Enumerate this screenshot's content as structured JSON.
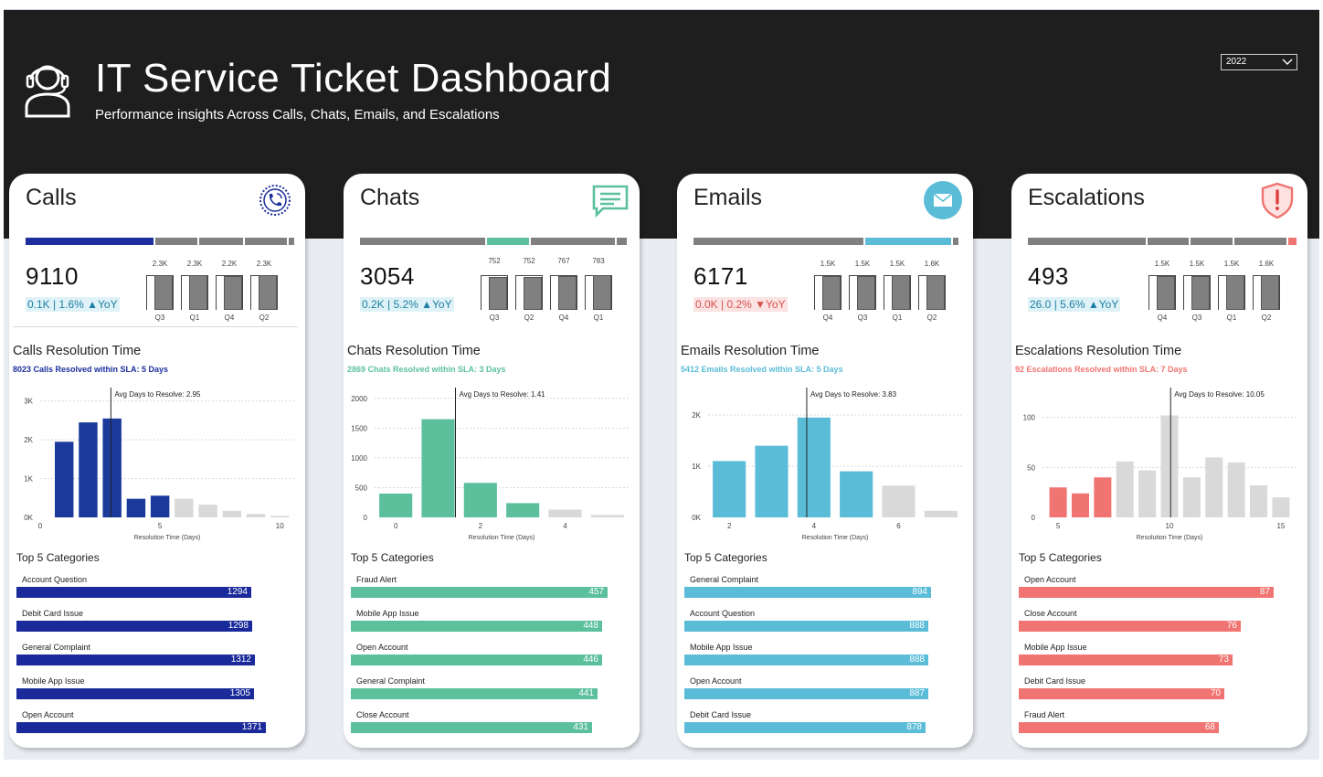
{
  "header": {
    "title": "IT Service Ticket Dashboard",
    "subtitle": "Performance insights Across Calls, Chats, Emails, and Escalations",
    "year_filter": "2022"
  },
  "common": {
    "top5_title": "Top 5 Categories",
    "avg_prefix": "Avg Days to Resolve: ",
    "x_axis_label": "Resolution Time (Days)"
  },
  "cards": [
    {
      "key": "calls",
      "title": "Calls",
      "icon": "phone-icon",
      "color": "#1c2f9c",
      "total": "9110",
      "yoy": "0.1K | 1.6% ▲YoY",
      "yoy_color": "#1c7fa3",
      "yoy_bg": "#dff2f7",
      "share_bar": [
        0.49,
        0.16,
        0.17,
        0.16,
        0.02
      ],
      "share_highlight": 0,
      "quarters": {
        "labels": [
          "Q3",
          "Q1",
          "Q4",
          "Q2"
        ],
        "values": [
          "2.3K",
          "2.3K",
          "2.2K",
          "2.3K"
        ],
        "fills": [
          0.99,
          1.0,
          0.98,
          0.99
        ]
      },
      "resolution_title": "Calls Resolution Time",
      "sla_text": "8023 Calls Resolved within SLA: 5 Days",
      "sla_color": "#1c2f9c",
      "avg_days": "2.95",
      "chart_data": {
        "type": "bar",
        "x": [
          1,
          2,
          3,
          4,
          5,
          6,
          7,
          8,
          9,
          10
        ],
        "values": [
          1950,
          2450,
          2550,
          480,
          560,
          480,
          330,
          170,
          90,
          40
        ],
        "highlight_upto": 5,
        "highlight_color": "#1c3a9c",
        "other_color": "#d9d9d9",
        "xticks": [
          "0",
          "5",
          "10"
        ],
        "xtick_vals": [
          0,
          5,
          10
        ],
        "yticks": [
          "0K",
          "1K",
          "2K",
          "3K"
        ],
        "ytick_vals": [
          0,
          1000,
          2000,
          3000
        ],
        "xlim": [
          0,
          10.6
        ],
        "ylim": [
          0,
          3300
        ],
        "avg": 2.95
      },
      "top_categories": [
        {
          "name": "Account Question",
          "value": "1294",
          "frac": 0.858
        },
        {
          "name": "Debit Card Issue",
          "value": "1298",
          "frac": 0.861
        },
        {
          "name": "General Complaint",
          "value": "1312",
          "frac": 0.87
        },
        {
          "name": "Mobile App Issue",
          "value": "1305",
          "frac": 0.865
        },
        {
          "name": "Open Account",
          "value": "1371",
          "frac": 0.909
        }
      ]
    },
    {
      "key": "chats",
      "title": "Chats",
      "icon": "chat-icon",
      "color": "#5cc09d",
      "total": "3054",
      "yoy": "0.2K | 5.2% ▲YoY",
      "yoy_color": "#1c7fa3",
      "yoy_bg": "#dff2f7",
      "share_bar": [
        0.48,
        0.16,
        0.32,
        0.04
      ],
      "share_highlight": 1,
      "quarters": {
        "labels": [
          "Q3",
          "Q2",
          "Q4",
          "Q1"
        ],
        "values": [
          "752",
          "752",
          "767",
          "783"
        ],
        "fills": [
          0.96,
          0.96,
          0.98,
          1.0
        ]
      },
      "resolution_title": "Chats Resolution Time",
      "sla_text": "2869 Chats Resolved within SLA: 3 Days",
      "sla_color": "#5cc09d",
      "avg_days": "1.41",
      "chart_data": {
        "type": "bar",
        "x": [
          0,
          1,
          2,
          3,
          4,
          5
        ],
        "values": [
          400,
          1650,
          580,
          240,
          130,
          40
        ],
        "highlight_upto": 3,
        "highlight_color": "#5cc09d",
        "other_color": "#d9d9d9",
        "xticks": [
          "0",
          "2",
          "4"
        ],
        "xtick_vals": [
          0,
          2,
          4
        ],
        "yticks": [
          "0",
          "500",
          "1000",
          "1500",
          "2000"
        ],
        "ytick_vals": [
          0,
          500,
          1000,
          1500,
          2000
        ],
        "xlim": [
          -0.5,
          5.5
        ],
        "ylim": [
          0,
          2150
        ],
        "avg": 1.41
      },
      "top_categories": [
        {
          "name": "Fraud Alert",
          "value": "457",
          "frac": 0.935
        },
        {
          "name": "Mobile App Issue",
          "value": "448",
          "frac": 0.915
        },
        {
          "name": "Open Account",
          "value": "446",
          "frac": 0.915
        },
        {
          "name": "General Complaint",
          "value": "441",
          "frac": 0.9
        },
        {
          "name": "Close Account",
          "value": "431",
          "frac": 0.88
        }
      ]
    },
    {
      "key": "emails",
      "title": "Emails",
      "icon": "mail-icon",
      "color": "#5bbcd8",
      "total": "6171",
      "yoy": "0.0K | 0.2% ▼YoY",
      "yoy_color": "#d9534f",
      "yoy_bg": "#fbe3e3",
      "share_bar": [
        0.65,
        0.33,
        0.02
      ],
      "share_highlight": 1,
      "quarters": {
        "labels": [
          "Q4",
          "Q3",
          "Q1",
          "Q2"
        ],
        "values": [
          "1.5K",
          "1.5K",
          "1.5K",
          "1.6K"
        ],
        "fills": [
          0.98,
          0.98,
          0.99,
          1.0
        ]
      },
      "resolution_title": "Emails Resolution Time",
      "sla_text": "5412 Emails Resolved within SLA: 5 Days",
      "sla_color": "#5bbcd8",
      "avg_days": "3.83",
      "chart_data": {
        "type": "bar",
        "x": [
          2,
          3,
          4,
          5,
          6,
          7
        ],
        "values": [
          1100,
          1400,
          1950,
          900,
          620,
          130
        ],
        "highlight_upto": 5,
        "highlight_color": "#5bbcd8",
        "other_color": "#d9d9d9",
        "xticks": [
          "2",
          "4",
          "6"
        ],
        "xtick_vals": [
          2,
          4,
          6
        ],
        "yticks": [
          "0K",
          "1K",
          "2K"
        ],
        "ytick_vals": [
          0,
          1000,
          2000
        ],
        "xlim": [
          1.5,
          7.5
        ],
        "ylim": [
          0,
          2500
        ],
        "avg": 3.83
      },
      "top_categories": [
        {
          "name": "General Complaint",
          "value": "894",
          "frac": 0.9
        },
        {
          "name": "Account Question",
          "value": "888",
          "frac": 0.89
        },
        {
          "name": "Mobile App Issue",
          "value": "888",
          "frac": 0.89
        },
        {
          "name": "Open Account",
          "value": "887",
          "frac": 0.89
        },
        {
          "name": "Debit Card Issue",
          "value": "878",
          "frac": 0.88
        }
      ]
    },
    {
      "key": "escalations",
      "title": "Escalations",
      "icon": "shield-alert-icon",
      "color": "#f07471",
      "total": "493",
      "yoy": "26.0 | 5.6% ▲YoY",
      "yoy_color": "#1c7fa3",
      "yoy_bg": "#dff2f7",
      "share_bar": [
        0.45,
        0.16,
        0.16,
        0.2,
        0.03
      ],
      "share_highlight": 4,
      "quarters": {
        "labels": [
          "Q4",
          "Q3",
          "Q1",
          "Q2"
        ],
        "values": [
          "1.5K",
          "1.5K",
          "1.5K",
          "1.6K"
        ],
        "fills": [
          0.98,
          0.98,
          0.99,
          1.0
        ]
      },
      "resolution_title": "Escalations Resolution Time",
      "sla_text": "92 Escalations Resolved within SLA: 7 Days",
      "sla_color": "#f07471",
      "avg_days": "10.05",
      "chart_data": {
        "type": "bar",
        "x": [
          5,
          6,
          7,
          8,
          9,
          10,
          11,
          12,
          13,
          14,
          15
        ],
        "values": [
          30,
          24,
          40,
          56,
          47,
          102,
          40,
          60,
          55,
          32,
          20
        ],
        "highlight_upto": 7,
        "highlight_color": "#f07471",
        "other_color": "#d9d9d9",
        "xticks": [
          "5",
          "10",
          "15"
        ],
        "xtick_vals": [
          5,
          10,
          15
        ],
        "yticks": [
          "0",
          "50",
          "100"
        ],
        "ytick_vals": [
          0,
          50,
          100
        ],
        "xlim": [
          4.3,
          15.7
        ],
        "ylim": [
          0,
          128
        ],
        "avg": 10.05
      },
      "top_categories": [
        {
          "name": "Open Account",
          "value": "87",
          "frac": 0.93
        },
        {
          "name": "Close Account",
          "value": "76",
          "frac": 0.81
        },
        {
          "name": "Mobile App Issue",
          "value": "73",
          "frac": 0.78
        },
        {
          "name": "Debit Card Issue",
          "value": "70",
          "frac": 0.75
        },
        {
          "name": "Fraud Alert",
          "value": "68",
          "frac": 0.73
        }
      ]
    }
  ]
}
